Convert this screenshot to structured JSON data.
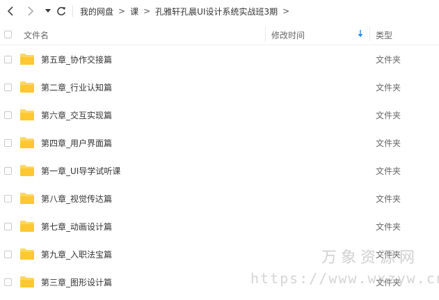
{
  "navbar": {
    "back_icon": "chevron-left-icon",
    "forward_icon": "chevron-right-icon",
    "dropdown_icon": "caret-down-icon",
    "refresh_icon": "refresh-icon",
    "breadcrumb": [
      {
        "label": "我的网盘"
      },
      {
        "label": "课"
      },
      {
        "label": "孔雅轩孔晨UI设计系统实战班3期"
      }
    ],
    "separator": ">"
  },
  "header": {
    "name_label": "文件名",
    "time_label": "修改时间",
    "type_label": "类型",
    "sort_icon": "arrow-down-icon",
    "accent_color": "#2b8ff6"
  },
  "folder_color": "#ffc832",
  "files": [
    {
      "name": "第五章_协作交接篇",
      "type": "文件夹"
    },
    {
      "name": "第二章_行业认知篇",
      "type": "文件夹"
    },
    {
      "name": "第六章_交互实现篇",
      "type": "文件夹"
    },
    {
      "name": "第四章_用户界面篇",
      "type": "文件夹"
    },
    {
      "name": "第一章_UI导学试听课",
      "type": "文件夹"
    },
    {
      "name": "第八章_视觉传达篇",
      "type": "文件夹"
    },
    {
      "name": "第七章_动画设计篇",
      "type": "文件夹"
    },
    {
      "name": "第九章_入职法宝篇",
      "type": "文件夹"
    },
    {
      "name": "第三章_图形设计篇",
      "type": "文件夹"
    }
  ],
  "watermark": {
    "title": "万象资源网",
    "url": "https://www.wxzyw.cn"
  }
}
